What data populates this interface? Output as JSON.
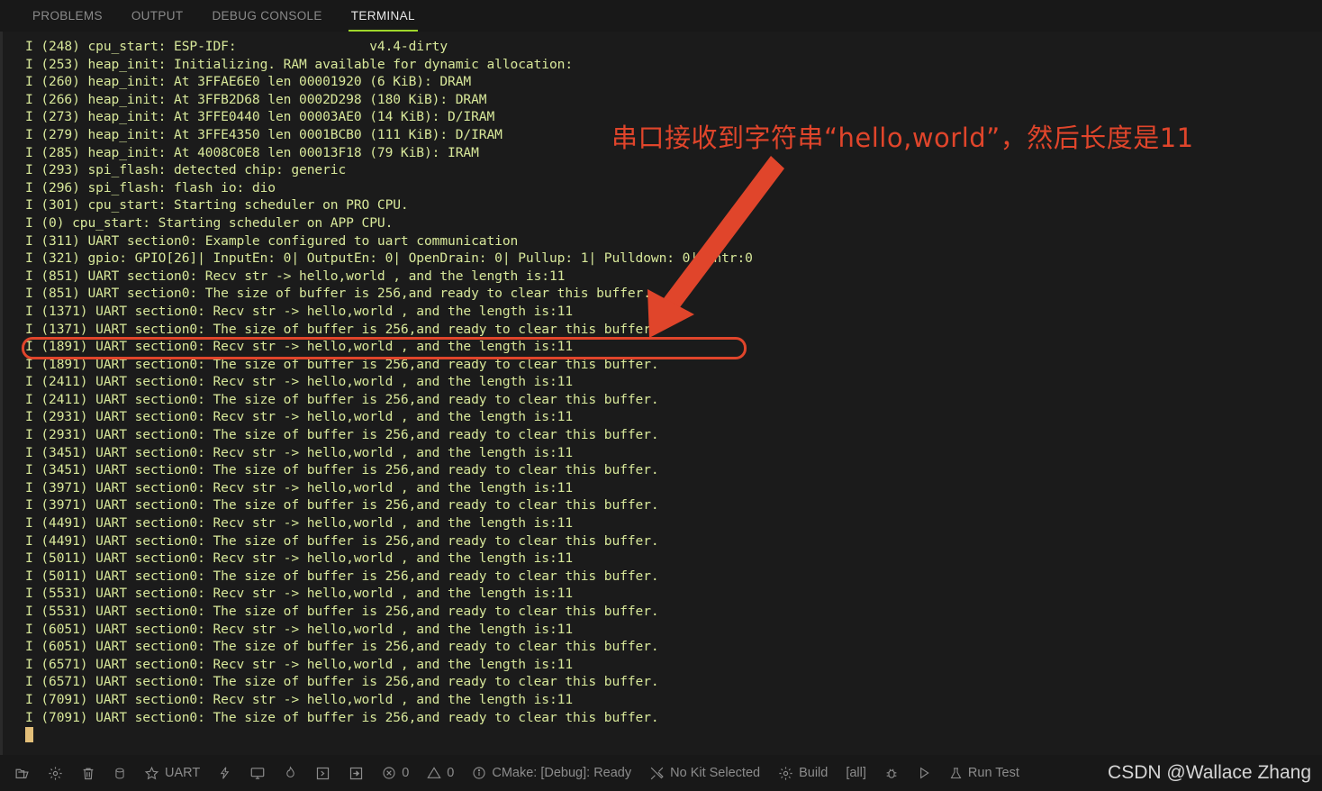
{
  "panel": {
    "tabs": [
      {
        "label": "PROBLEMS",
        "active": false
      },
      {
        "label": "OUTPUT",
        "active": false
      },
      {
        "label": "DEBUG CONSOLE",
        "active": false
      },
      {
        "label": "TERMINAL",
        "active": true
      }
    ],
    "accent_color": "#9fd62a"
  },
  "terminal": {
    "text_color": "#d8e89a",
    "background": "#1b1b1b",
    "cursor_color": "#e3bf79",
    "lines": [
      "I (248) cpu_start: ESP-IDF:                 v4.4-dirty",
      "I (253) heap_init: Initializing. RAM available for dynamic allocation:",
      "I (260) heap_init: At 3FFAE6E0 len 00001920 (6 KiB): DRAM",
      "I (266) heap_init: At 3FFB2D68 len 0002D298 (180 KiB): DRAM",
      "I (273) heap_init: At 3FFE0440 len 00003AE0 (14 KiB): D/IRAM",
      "I (279) heap_init: At 3FFE4350 len 0001BCB0 (111 KiB): D/IRAM",
      "I (285) heap_init: At 4008C0E8 len 00013F18 (79 KiB): IRAM",
      "I (293) spi_flash: detected chip: generic",
      "I (296) spi_flash: flash io: dio",
      "I (301) cpu_start: Starting scheduler on PRO CPU.",
      "I (0) cpu_start: Starting scheduler on APP CPU.",
      "I (311) UART section0: Example configured to uart communication",
      "I (321) gpio: GPIO[26]| InputEn: 0| OutputEn: 0| OpenDrain: 0| Pullup: 1| Pulldown: 0| Intr:0",
      "I (851) UART section0: Recv str -> hello,world , and the length is:11",
      "I (851) UART section0: The size of buffer is 256,and ready to clear this buffer.",
      "I (1371) UART section0: Recv str -> hello,world , and the length is:11",
      "I (1371) UART section0: The size of buffer is 256,and ready to clear this buffer.",
      "I (1891) UART section0: Recv str -> hello,world , and the length is:11",
      "I (1891) UART section0: The size of buffer is 256,and ready to clear this buffer.",
      "I (2411) UART section0: Recv str -> hello,world , and the length is:11",
      "I (2411) UART section0: The size of buffer is 256,and ready to clear this buffer.",
      "I (2931) UART section0: Recv str -> hello,world , and the length is:11",
      "I (2931) UART section0: The size of buffer is 256,and ready to clear this buffer.",
      "I (3451) UART section0: Recv str -> hello,world , and the length is:11",
      "I (3451) UART section0: The size of buffer is 256,and ready to clear this buffer.",
      "I (3971) UART section0: Recv str -> hello,world , and the length is:11",
      "I (3971) UART section0: The size of buffer is 256,and ready to clear this buffer.",
      "I (4491) UART section0: Recv str -> hello,world , and the length is:11",
      "I (4491) UART section0: The size of buffer is 256,and ready to clear this buffer.",
      "I (5011) UART section0: Recv str -> hello,world , and the length is:11",
      "I (5011) UART section0: The size of buffer is 256,and ready to clear this buffer.",
      "I (5531) UART section0: Recv str -> hello,world , and the length is:11",
      "I (5531) UART section0: The size of buffer is 256,and ready to clear this buffer.",
      "I (6051) UART section0: Recv str -> hello,world , and the length is:11",
      "I (6051) UART section0: The size of buffer is 256,and ready to clear this buffer.",
      "I (6571) UART section0: Recv str -> hello,world , and the length is:11",
      "I (6571) UART section0: The size of buffer is 256,and ready to clear this buffer.",
      "I (7091) UART section0: Recv str -> hello,world , and the length is:11",
      "I (7091) UART section0: The size of buffer is 256,and ready to clear this buffer."
    ]
  },
  "annotations": {
    "color": "#e0452b",
    "note_text": "串口接收到字符串“hello,world”，然后长度是11",
    "highlighted_line": "I (1371) UART section0: Recv str -> hello,world , and the length is:11"
  },
  "statusbar": {
    "items": [
      {
        "name": "open-folder-icon",
        "icon": "folder",
        "label": ""
      },
      {
        "name": "gear-icon",
        "icon": "gear",
        "label": ""
      },
      {
        "name": "trash-icon",
        "icon": "trash",
        "label": ""
      },
      {
        "name": "database-icon",
        "icon": "database",
        "label": ""
      },
      {
        "name": "serial-port-uart",
        "icon": "star",
        "label": "UART"
      },
      {
        "name": "flash-icon",
        "icon": "lightning",
        "label": ""
      },
      {
        "name": "monitor-icon",
        "icon": "monitor",
        "label": ""
      },
      {
        "name": "flame-icon",
        "icon": "flame",
        "label": ""
      },
      {
        "name": "terminal-icon",
        "icon": "chevron-box",
        "label": ""
      },
      {
        "name": "arrow-box-icon",
        "icon": "arrow-box",
        "label": ""
      },
      {
        "name": "errors-count",
        "icon": "error-circle",
        "label": "0"
      },
      {
        "name": "warnings-count",
        "icon": "warning-triangle",
        "label": "0"
      },
      {
        "name": "cmake-status",
        "icon": "info-circle",
        "label": "CMake: [Debug]: Ready"
      },
      {
        "name": "kit-selector",
        "icon": "tools",
        "label": "No Kit Selected"
      },
      {
        "name": "build-button",
        "icon": "gear",
        "label": "Build"
      },
      {
        "name": "build-target",
        "icon": "",
        "label": "[all]"
      },
      {
        "name": "debug-button",
        "icon": "bug",
        "label": ""
      },
      {
        "name": "launch-button",
        "icon": "play",
        "label": ""
      },
      {
        "name": "run-test-button",
        "icon": "flask",
        "label": "Run Test"
      }
    ]
  },
  "watermark": {
    "text": "CSDN @Wallace Zhang"
  }
}
